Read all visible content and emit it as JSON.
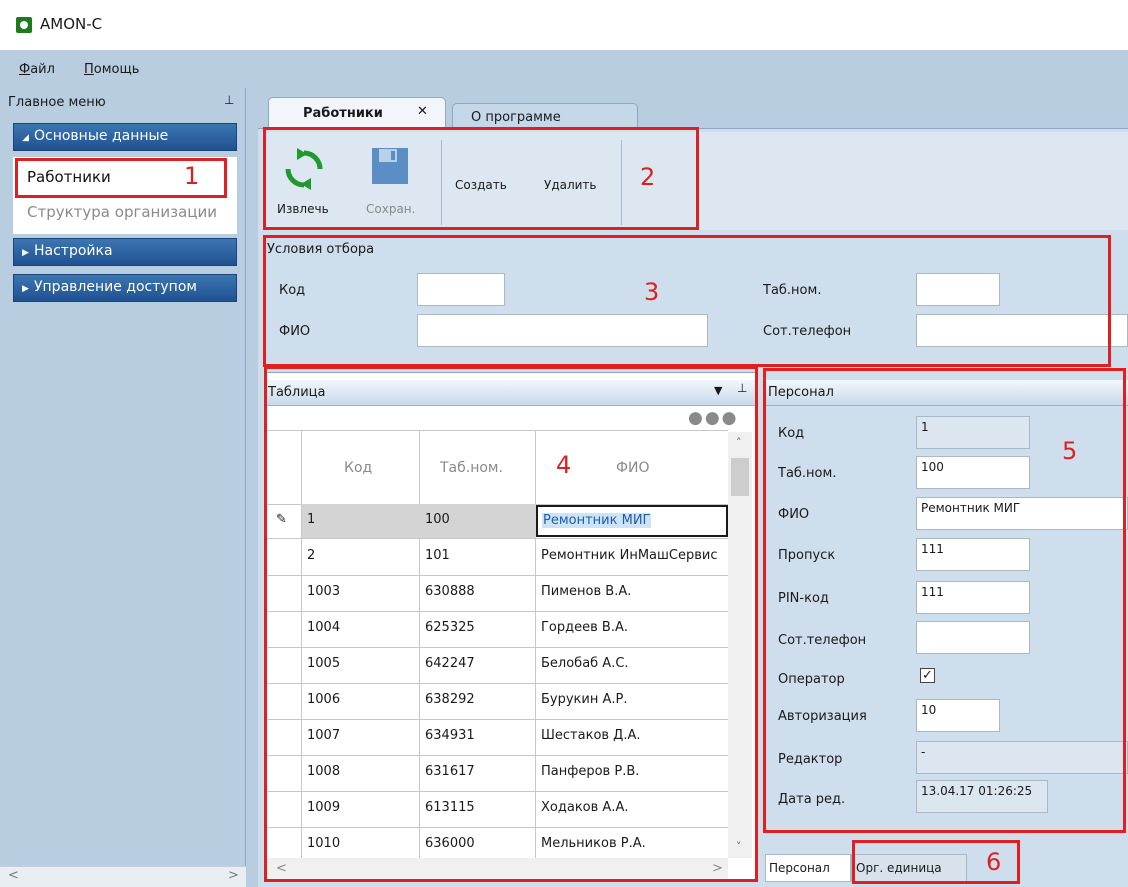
{
  "window": {
    "title": "AMON-C"
  },
  "menu": {
    "file": "айл",
    "file_accel": "Ф",
    "help": "омощь",
    "help_accel": "П"
  },
  "left_panel": {
    "header": "Главное меню",
    "groups": [
      {
        "label": "Основные данные",
        "expanded": true
      },
      {
        "label": "Настройка",
        "expanded": false
      },
      {
        "label": "Управление доступом",
        "expanded": false
      }
    ],
    "items": [
      "Работники",
      "Структура организации"
    ]
  },
  "tabs": [
    {
      "label": "Работники",
      "close": "✕"
    },
    {
      "label": "О программе"
    }
  ],
  "toolbar": {
    "fetch": "Извлечь",
    "save": "Сохран.",
    "create": "Создать",
    "delete": "Удалить"
  },
  "filter": {
    "title": "Условия отбора",
    "code_label": "Код",
    "fio_label": "ФИО",
    "tabnum_label": "Таб.ном.",
    "phone_label": "Сот.телефон",
    "code_value": "",
    "fio_value": "",
    "tabnum_value": "",
    "phone_value": ""
  },
  "table": {
    "title": "Таблица",
    "columns": [
      "Код",
      "Таб.ном.",
      "ФИО"
    ],
    "rows": [
      {
        "code": "1",
        "tab": "100",
        "fio": "Ремонтник МИГ"
      },
      {
        "code": "2",
        "tab": "101",
        "fio": "Ремонтник ИнМашСервис"
      },
      {
        "code": "1003",
        "tab": "630888",
        "fio": "Пименов В.А."
      },
      {
        "code": "1004",
        "tab": "625325",
        "fio": "Гордеев В.А."
      },
      {
        "code": "1005",
        "tab": "642247",
        "fio": "Белобаб А.С."
      },
      {
        "code": "1006",
        "tab": "638292",
        "fio": "Бурукин А.Р."
      },
      {
        "code": "1007",
        "tab": "634931",
        "fio": "Шестаков Д.А."
      },
      {
        "code": "1008",
        "tab": "631617",
        "fio": "Панферов Р.В."
      },
      {
        "code": "1009",
        "tab": "613115",
        "fio": "Ходаков А.А."
      },
      {
        "code": "1010",
        "tab": "636000",
        "fio": "Мельников Р.А."
      }
    ]
  },
  "personal": {
    "title": "Персонал",
    "labels": {
      "code": "Код",
      "tab": "Таб.ном.",
      "fio": "ФИО",
      "pass": "Пропуск",
      "pin": "PIN-код",
      "phone": "Сот.телефон",
      "operator": "Оператор",
      "auth": "Авторизация",
      "editor": "Редактор",
      "edit_date": "Дата ред."
    },
    "values": {
      "code": "1",
      "tab": "100",
      "fio": "Ремонтник МИГ",
      "pass": "111",
      "pin": "111",
      "phone": "",
      "operator": "✓",
      "auth": "10",
      "editor": "-",
      "edit_date": "13.04.17  01:26:25"
    }
  },
  "bottom_tabs": [
    "Персонал",
    "Орг. единица"
  ],
  "callouts": [
    "1",
    "2",
    "3",
    "4",
    "5",
    "6"
  ],
  "colors": {
    "callout": "#e02020",
    "nav_group": "#2a5f9e",
    "background": "#b9cde0"
  }
}
